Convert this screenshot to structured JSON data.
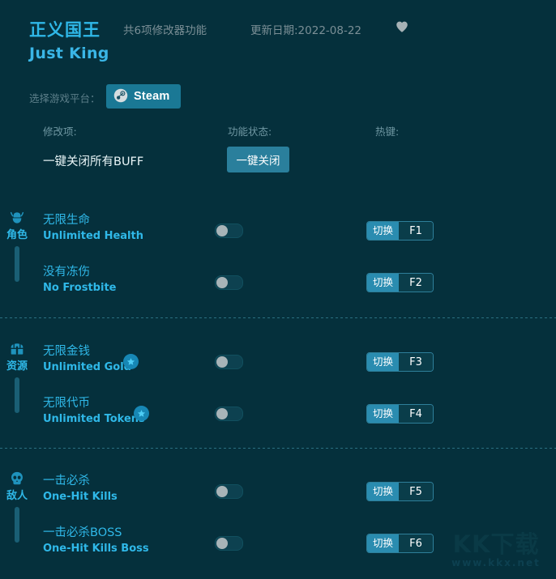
{
  "header": {
    "title_cn": "正义国王",
    "title_en": "Just King",
    "feature_count": "共6项修改器功能",
    "update_date": "更新日期:2022-08-22",
    "favorite_icon": "heart-icon"
  },
  "platform": {
    "label": "选择游戏平台：",
    "selected": "Steam",
    "icon": "steam-icon"
  },
  "columns": {
    "item": "修改项:",
    "status": "功能状态:",
    "hotkey": "热键:"
  },
  "global": {
    "label": "一键关闭所有BUFF",
    "button": "一键关闭"
  },
  "sections": [
    {
      "category_cn": "角色",
      "category_icon": "helmet-icon",
      "rows": [
        {
          "name_cn": "无限生命",
          "name_en": "Unlimited Health",
          "premium": false,
          "toggle_state": "off",
          "hotkey_action": "切换",
          "hotkey_key": "F1"
        },
        {
          "name_cn": "没有冻伤",
          "name_en": "No Frostbite",
          "premium": false,
          "toggle_state": "off",
          "hotkey_action": "切换",
          "hotkey_key": "F2"
        }
      ]
    },
    {
      "category_cn": "资源",
      "category_icon": "chest-icon",
      "rows": [
        {
          "name_cn": "无限金钱",
          "name_en": "Unlimited Gold",
          "premium": true,
          "toggle_state": "off",
          "hotkey_action": "切换",
          "hotkey_key": "F3"
        },
        {
          "name_cn": "无限代币",
          "name_en": "Unlimited Tokens",
          "premium": true,
          "toggle_state": "off",
          "hotkey_action": "切换",
          "hotkey_key": "F4"
        }
      ]
    },
    {
      "category_cn": "敌人",
      "category_icon": "skull-icon",
      "rows": [
        {
          "name_cn": "一击必杀",
          "name_en": "One-Hit Kills",
          "premium": false,
          "toggle_state": "off",
          "hotkey_action": "切换",
          "hotkey_key": "F5"
        },
        {
          "name_cn": "一击必杀BOSS",
          "name_en": "One-Hit Kills Boss",
          "premium": false,
          "toggle_state": "off",
          "hotkey_action": "切换",
          "hotkey_key": "F6"
        }
      ]
    }
  ],
  "watermark": {
    "main": "KK下载",
    "sub": "www.kkx.net"
  },
  "colors": {
    "background": "#05303c",
    "accent": "#2fb8e8",
    "button": "#2a7f9c",
    "steam": "#1a7895",
    "muted": "#7b8f96"
  }
}
